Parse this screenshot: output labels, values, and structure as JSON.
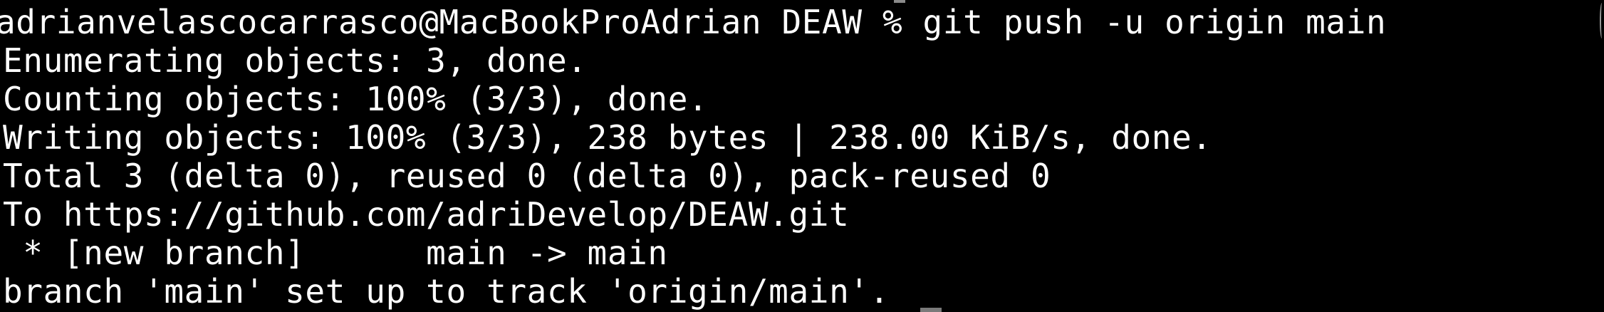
{
  "terminal": {
    "background": "#000000",
    "foreground": "#ffffff",
    "lines": [
      "adrianvelascocarrasco@MacBookProAdrian DEAW % git push -u origin main",
      "Enumerating objects: 3, done.",
      "Counting objects: 100% (3/3), done.",
      "Writing objects: 100% (3/3), 238 bytes | 238.00 KiB/s, done.",
      "Total 3 (delta 0), reused 0 (delta 0), pack-reused 0",
      "To https://github.com/adriDevelop/DEAW.git",
      " * [new branch]      main -> main",
      "branch 'main' set up to track 'origin/main'."
    ]
  }
}
